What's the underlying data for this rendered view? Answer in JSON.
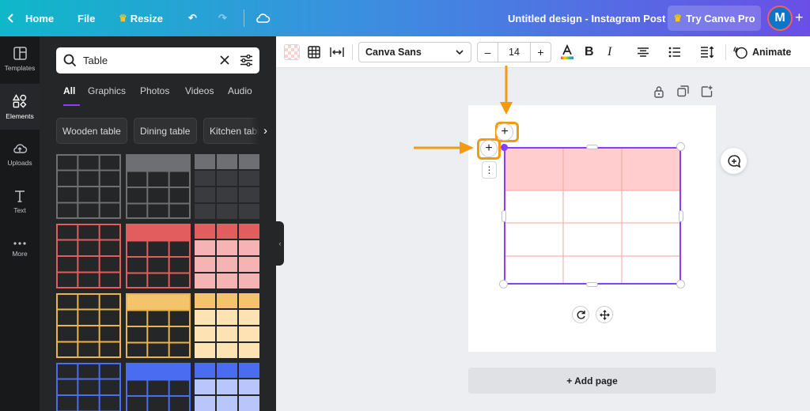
{
  "topbar": {
    "home": "Home",
    "file": "File",
    "resize": "Resize",
    "title": "Untitled design - Instagram Post",
    "try_pro": "Try Canva Pro",
    "avatar_initial": "M"
  },
  "rail": {
    "items": [
      {
        "label": "Templates",
        "icon": "templates-icon"
      },
      {
        "label": "Elements",
        "icon": "elements-icon"
      },
      {
        "label": "Uploads",
        "icon": "uploads-icon"
      },
      {
        "label": "Text",
        "icon": "text-icon"
      },
      {
        "label": "More",
        "icon": "more-icon"
      }
    ]
  },
  "panel": {
    "search_value": "Table",
    "tabs": [
      "All",
      "Graphics",
      "Photos",
      "Videos",
      "Audio"
    ],
    "active_tab": "All",
    "chips": [
      "Wooden table",
      "Dining table",
      "Kitchen table"
    ]
  },
  "toolbar": {
    "font": "Canva Sans",
    "font_size": "14",
    "minus": "–",
    "plus": "+",
    "bold": "B",
    "italic": "I",
    "animate": "Animate"
  },
  "canvas": {
    "add_page": "+ Add page",
    "table": {
      "rows": 4,
      "cols": 3,
      "header_color": "#ffcdcd",
      "line_color": "#f4a3a3"
    }
  },
  "colors": {
    "accent": "#8b3dff",
    "highlight": "#f39a13"
  }
}
